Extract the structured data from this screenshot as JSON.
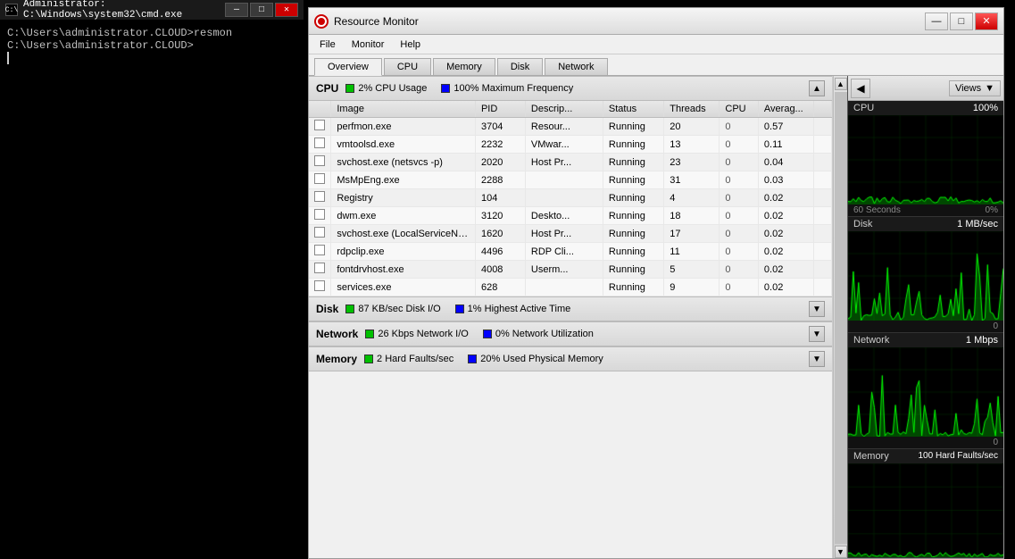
{
  "cmd": {
    "title": "Administrator: C:\\Windows\\system32\\cmd.exe",
    "icon": "C:\\>",
    "lines": [
      "C:\\Users\\administrator.CLOUD>resmon",
      "C:\\Users\\administrator.CLOUD>"
    ],
    "controls": {
      "minimize": "—",
      "maximize": "□",
      "close": "✕"
    }
  },
  "resmon": {
    "title": "Resource Monitor",
    "controls": {
      "minimize": "—",
      "maximize": "□",
      "close": "✕"
    },
    "menu": [
      "File",
      "Monitor",
      "Help"
    ],
    "tabs": [
      "Overview",
      "CPU",
      "Memory",
      "Disk",
      "Network"
    ],
    "active_tab": "Overview",
    "sections": {
      "cpu": {
        "title": "CPU",
        "stat1_dot": "green",
        "stat1_label": "2% CPU Usage",
        "stat2_dot": "blue",
        "stat2_label": "100% Maximum Frequency",
        "columns": [
          "Image",
          "PID",
          "Descrip...",
          "Status",
          "Threads",
          "CPU",
          "Averag..."
        ],
        "rows": [
          {
            "image": "perfmon.exe",
            "pid": "3704",
            "desc": "Resour...",
            "status": "Running",
            "threads": "20",
            "cpu": "0",
            "avg": "0.57"
          },
          {
            "image": "vmtoolsd.exe",
            "pid": "2232",
            "desc": "VMwar...",
            "status": "Running",
            "threads": "13",
            "cpu": "0",
            "avg": "0.11"
          },
          {
            "image": "svchost.exe (netsvcs -p)",
            "pid": "2020",
            "desc": "Host Pr...",
            "status": "Running",
            "threads": "23",
            "cpu": "0",
            "avg": "0.04"
          },
          {
            "image": "MsMpEng.exe",
            "pid": "2288",
            "desc": "",
            "status": "Running",
            "threads": "31",
            "cpu": "0",
            "avg": "0.03"
          },
          {
            "image": "Registry",
            "pid": "104",
            "desc": "",
            "status": "Running",
            "threads": "4",
            "cpu": "0",
            "avg": "0.02"
          },
          {
            "image": "dwm.exe",
            "pid": "3120",
            "desc": "Deskto...",
            "status": "Running",
            "threads": "18",
            "cpu": "0",
            "avg": "0.02"
          },
          {
            "image": "svchost.exe (LocalServiceNo...",
            "pid": "1620",
            "desc": "Host Pr...",
            "status": "Running",
            "threads": "17",
            "cpu": "0",
            "avg": "0.02"
          },
          {
            "image": "rdpclip.exe",
            "pid": "4496",
            "desc": "RDP Cli...",
            "status": "Running",
            "threads": "11",
            "cpu": "0",
            "avg": "0.02"
          },
          {
            "image": "fontdrvhost.exe",
            "pid": "4008",
            "desc": "Userm...",
            "status": "Running",
            "threads": "5",
            "cpu": "0",
            "avg": "0.02"
          },
          {
            "image": "services.exe",
            "pid": "628",
            "desc": "",
            "status": "Running",
            "threads": "9",
            "cpu": "0",
            "avg": "0.02"
          }
        ]
      },
      "disk": {
        "title": "Disk",
        "stat1_label": "87 KB/sec Disk I/O",
        "stat2_label": "1% Highest Active Time"
      },
      "network": {
        "title": "Network",
        "stat1_label": "26 Kbps Network I/O",
        "stat2_label": "0% Network Utilization"
      },
      "memory": {
        "title": "Memory",
        "stat1_label": "2 Hard Faults/sec",
        "stat2_label": "20% Used Physical Memory"
      }
    },
    "graphs": {
      "cpu": {
        "label": "CPU",
        "value": "100%",
        "footer_left": "60 Seconds",
        "footer_right": "0%"
      },
      "disk": {
        "label": "Disk",
        "value": "1 MB/sec",
        "footer_left": "",
        "footer_right": "0"
      },
      "network": {
        "label": "Network",
        "value": "1 Mbps",
        "footer_left": "",
        "footer_right": "0"
      },
      "memory": {
        "label": "Memory",
        "value": "100 Hard Faults/sec",
        "footer_left": "",
        "footer_right": ""
      }
    },
    "views_label": "Views"
  }
}
